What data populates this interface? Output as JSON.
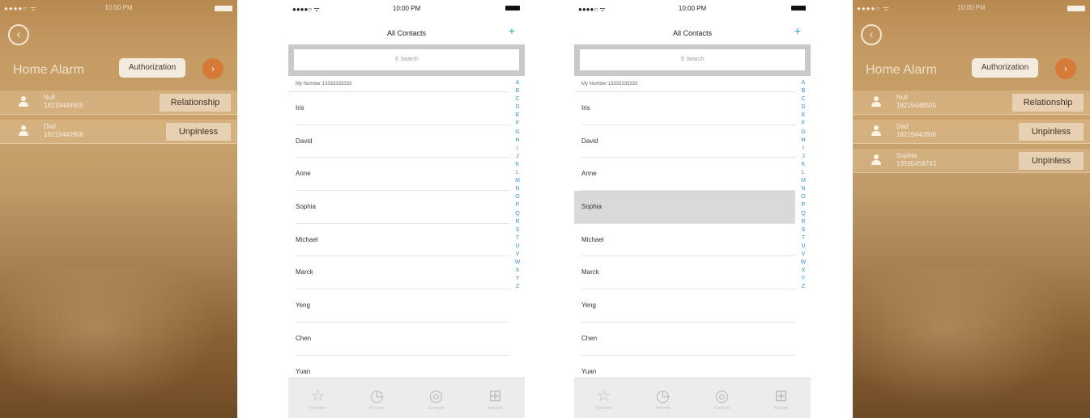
{
  "screen1": {
    "status_time": "10:00 PM",
    "back_icon": "back-circle-icon",
    "title": "Home Alarm",
    "authorization_label": "Authorization",
    "contacts": [
      {
        "name": "Null",
        "phone": "18219448505",
        "action": "Relationship"
      },
      {
        "name": "Dad",
        "phone": "18219440906",
        "action": "Unpinless"
      }
    ]
  },
  "screen2": {
    "status_time": "10:00 PM",
    "title": "All Contacts",
    "add_icon": "plus-icon",
    "search_placeholder": "Search",
    "my_number": "My Number:13333333333",
    "contacts": [
      "Iris",
      "David",
      "Anne",
      "Sophia",
      "Michael",
      "Marck",
      "Yeng",
      "Chen",
      "Yuan"
    ],
    "selected": null,
    "alphabet": [
      "A",
      "B",
      "C",
      "D",
      "E",
      "F",
      "G",
      "H",
      "I",
      "J",
      "K",
      "L",
      "M",
      "N",
      "O",
      "P",
      "Q",
      "R",
      "S",
      "T",
      "U",
      "V",
      "W",
      "X",
      "Y",
      "Z"
    ],
    "tabs": [
      {
        "icon": "star-icon",
        "label": "Favorites"
      },
      {
        "icon": "clock-icon",
        "label": "Recents"
      },
      {
        "icon": "contacts-icon",
        "label": "Contacts"
      },
      {
        "icon": "keypad-icon",
        "label": "Keypad"
      }
    ]
  },
  "screen3": {
    "status_time": "10:00 PM",
    "title": "All Contacts",
    "add_icon": "plus-icon",
    "search_placeholder": "Search",
    "my_number": "My Number:13333333333",
    "contacts": [
      "Iris",
      "David",
      "Anne",
      "Sophia",
      "Michael",
      "Marck",
      "Yeng",
      "Chen",
      "Yuan"
    ],
    "selected": "Sophia",
    "alphabet": [
      "A",
      "B",
      "C",
      "D",
      "E",
      "F",
      "G",
      "H",
      "I",
      "J",
      "K",
      "L",
      "M",
      "N",
      "O",
      "P",
      "Q",
      "R",
      "S",
      "T",
      "U",
      "V",
      "W",
      "X",
      "Y",
      "Z"
    ],
    "tabs": [
      {
        "icon": "star-icon",
        "label": "Favorites"
      },
      {
        "icon": "clock-icon",
        "label": "Recents"
      },
      {
        "icon": "contacts-icon",
        "label": "Contacts"
      },
      {
        "icon": "keypad-icon",
        "label": "Keypad"
      }
    ]
  },
  "screen4": {
    "status_time": "10:00 PM",
    "back_icon": "back-circle-icon",
    "title": "Home Alarm",
    "authorization_label": "Authorization",
    "contacts": [
      {
        "name": "Null",
        "phone": "18219448505",
        "action": "Relationship"
      },
      {
        "name": "Dad",
        "phone": "18219440906",
        "action": "Unpinless"
      },
      {
        "name": "Sophia",
        "phone": "13565458743",
        "action": "Unpinless"
      }
    ]
  },
  "colors": {
    "gold_bg": "#c59a63",
    "go_button": "#d67a36",
    "accent_blue": "#2f9fd8",
    "selected_row": "#d9d9d9"
  }
}
